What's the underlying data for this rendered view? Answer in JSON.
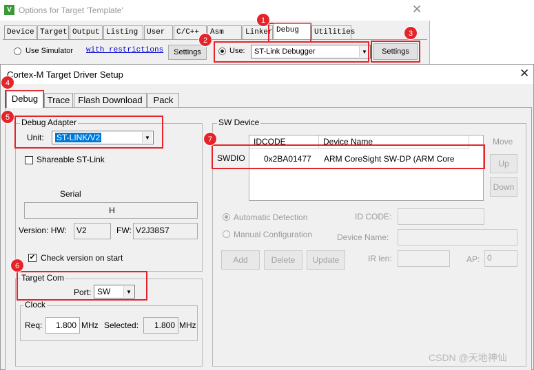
{
  "back_window": {
    "title": "Options for Target 'Template'",
    "tabs": [
      "Device",
      "Target",
      "Output",
      "Listing",
      "User",
      "C/C++",
      "Asm",
      "Linker",
      "Debug",
      "Utilities"
    ],
    "use_simulator_label": "Use Simulator",
    "restrictions_link": "with restrictions",
    "settings_label": "Settings",
    "use_label": "Use:",
    "debugger_value": "ST-Link Debugger",
    "settings_label_right": "Settings"
  },
  "dialog": {
    "title": "Cortex-M Target Driver Setup",
    "tabs": [
      "Debug",
      "Trace",
      "Flash Download",
      "Pack"
    ]
  },
  "debug_adapter": {
    "title": "Debug Adapter",
    "unit_label": "Unit:",
    "unit_value": "ST-LINK/V2",
    "shareable_label": "Shareable ST-Link",
    "serial_label": "Serial",
    "serial_value": "H",
    "version_hw_label": "Version: HW:",
    "hw_value": "V2",
    "fw_label": "FW:",
    "fw_value": "V2J38S7",
    "check_version_label": "Check version on start"
  },
  "target_com": {
    "title": "Target Com",
    "port_label": "Port:",
    "port_value": "SW",
    "clock_title": "Clock",
    "req_label": "Req:",
    "req_value": "1.800",
    "mhz_label": "MHz",
    "selected_label": "Selected:",
    "selected_value": "1.800",
    "mhz_label_2": "MHz"
  },
  "sw_device": {
    "title": "SW Device",
    "columns": [
      "IDCODE",
      "Device Name"
    ],
    "row_label": "SWDIO",
    "idcode": "0x2BA01477",
    "device_name": "ARM CoreSight SW-DP (ARM Core",
    "move_label": "Move",
    "up_label": "Up",
    "down_label": "Down",
    "auto_detect_label": "Automatic Detection",
    "manual_config_label": "Manual Configuration",
    "id_code_label": "ID CODE:",
    "device_name_label": "Device Name:",
    "ir_len_label": "IR len:",
    "ap_label": "AP:",
    "ap_value": "0",
    "add_label": "Add",
    "delete_label": "Delete",
    "update_label": "Update"
  },
  "annotations": [
    "1",
    "2",
    "3",
    "4",
    "5",
    "6",
    "7"
  ],
  "watermark": "CSDN @天地神仙",
  "colors": {
    "annotation_red": "#e4242a",
    "selection_blue": "#0078d7"
  }
}
